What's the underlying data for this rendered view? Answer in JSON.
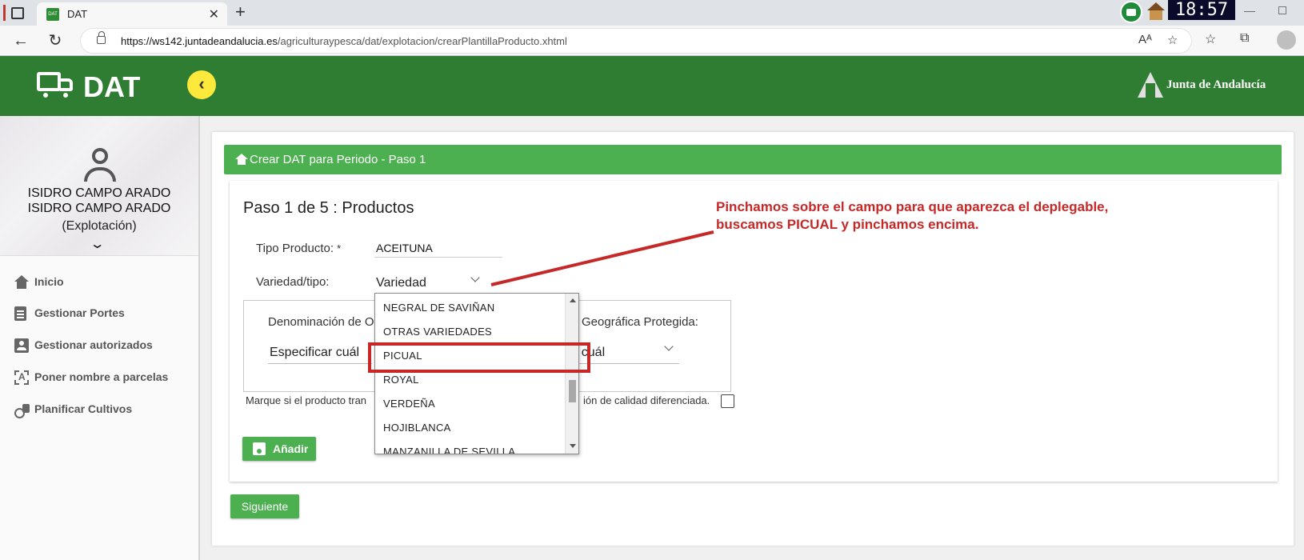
{
  "browser": {
    "tab_title": "DAT",
    "tab_favicon_text": "DAT",
    "url_host": "https://ws142.juntadeandalucia.es",
    "url_path": "/agriculturaypesca/dat/explotacion/crearPlantillaProducto.xhtml",
    "clock": "18:57"
  },
  "header": {
    "app_title": "DAT",
    "org": "Junta de Andalucía"
  },
  "user": {
    "name_line1": "ISIDRO CAMPO ARADO",
    "name_line2": "ISIDRO CAMPO ARADO",
    "role": "(Explotación)"
  },
  "sidebar": {
    "items": [
      {
        "label": "Inicio",
        "icon": "home-icon"
      },
      {
        "label": "Gestionar Portes",
        "icon": "clipboard-icon"
      },
      {
        "label": "Gestionar autorizados",
        "icon": "id-badge-icon"
      },
      {
        "label": "Poner nombre a parcelas",
        "icon": "frame-text-icon"
      },
      {
        "label": "Planificar Cultivos",
        "icon": "tractor-icon"
      }
    ]
  },
  "panel": {
    "title": "Crear DAT para Periodo - Paso 1",
    "step_title": "Paso 1 de 5 : Productos"
  },
  "annotation": {
    "line1": "Pinchamos sobre el campo para que aparezca el deplegable,",
    "line2": "buscamos PICUAL y pinchamos encima."
  },
  "form": {
    "tipo_label": "Tipo Producto:",
    "tipo_required": "*",
    "tipo_value": "ACEITUNA",
    "variedad_label": "Variedad/tipo:",
    "variedad_value": "Variedad",
    "den_label_left": "Denominación de O",
    "den_label_right": "Geográfica Protegida:",
    "den_select_left": "Especificar cuál",
    "den_select_right": "r cuál",
    "marque_left": "Marque si el producto tran",
    "marque_right": "ión de calidad diferenciada.",
    "add_button": "Añadir",
    "next_button": "Siguiente"
  },
  "dropdown": {
    "options": [
      "NEGRAL DE SAVIÑAN",
      "OTRAS VARIEDADES",
      "PICUAL",
      "ROYAL",
      "VERDEÑA",
      "HOJIBLANCA",
      "MANZANILLA DE SEVILLA"
    ],
    "highlighted": "PICUAL"
  },
  "colors": {
    "header_green": "#2e7d32",
    "accent_green": "#4caf50",
    "annotation_red": "#c62828",
    "collapse_yellow": "#fde93b"
  }
}
